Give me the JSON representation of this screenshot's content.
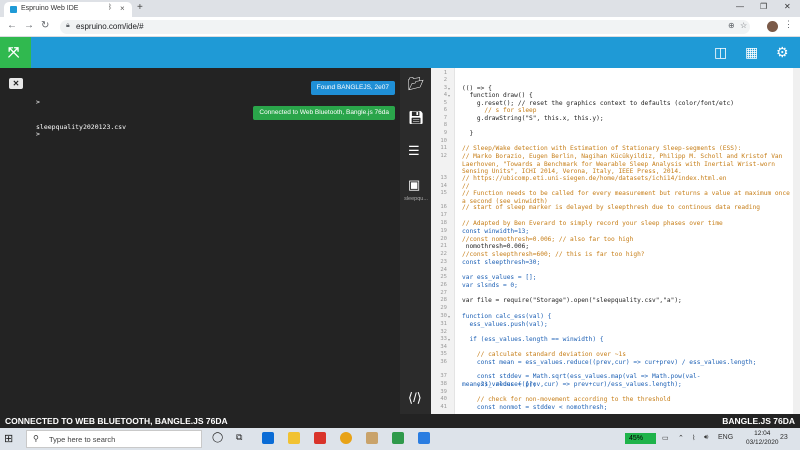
{
  "browser": {
    "tab_title": "Espruino Web IDE",
    "url": "espruino.com/ide/#"
  },
  "terminal": {
    "prompt_1": ">",
    "prompt_2": ">",
    "file_line": "sleepquality2020123.csv",
    "toast_found": "Found BANGLEJS, 2e07",
    "toast_connected": "Connected to Web Bluetooth, Bangle.js 76da"
  },
  "sidebar": {
    "tool_label": "sleepqu..."
  },
  "editor": {
    "lines": [
      {
        "n": "1",
        "t": "",
        "c": "plain"
      },
      {
        "n": "2",
        "t": "",
        "c": "plain"
      },
      {
        "n": "3",
        "t": "(() => {",
        "c": "plain",
        "f": true
      },
      {
        "n": "4",
        "t": "  function draw() {",
        "c": "plain",
        "f": true
      },
      {
        "n": "5",
        "t": "    g.reset(); // reset the graphics context to defaults (color/font/etc)",
        "c": "plain"
      },
      {
        "n": "6",
        "t": "      // s for sleep",
        "c": "comment"
      },
      {
        "n": "7",
        "t": "    g.drawString(\"S\", this.x, this.y);",
        "c": "plain"
      },
      {
        "n": "8",
        "t": "",
        "c": "plain"
      },
      {
        "n": "9",
        "t": "  }",
        "c": "plain"
      },
      {
        "n": "10",
        "t": "",
        "c": "plain"
      },
      {
        "n": "11",
        "t": "// Sleep/Wake detection with Estimation of Stationary Sleep-segments (ESS):",
        "c": "comment"
      },
      {
        "n": "12",
        "t": "// Marko Borazio, Eugen Berlin, Nagihan Kücükyildiz, Philipp M. Scholl and Kristof Van Laerhoven, \"Towards a Benchmark for Wearable Sleep Analysis with Inertial Wrist-worn Sensing Units\", ICHI 2014, Verona, Italy, IEEE Press, 2014.",
        "c": "comment"
      },
      {
        "n": "13",
        "t": "// https://ubicomp.eti.uni-siegen.de/home/datasets/ichi14/index.html.en",
        "c": "comment"
      },
      {
        "n": "14",
        "t": "//",
        "c": "comment"
      },
      {
        "n": "15",
        "t": "// Function needs to be called for every measurement but returns a value at maximum once a second (see winwidth)",
        "c": "comment"
      },
      {
        "n": "16",
        "t": "// start of sleep marker is delayed by sleepthresh due to continous data reading",
        "c": "comment"
      },
      {
        "n": "17",
        "t": "",
        "c": "plain"
      },
      {
        "n": "18",
        "t": "// Adapted by Ben Everard to simply record your sleep phases over time",
        "c": "comment"
      },
      {
        "n": "19",
        "t": "const winwidth=13;",
        "c": "kw"
      },
      {
        "n": "20",
        "t": "//const nomothresh=0.006; // also far too high",
        "c": "comment"
      },
      {
        "n": "21",
        "t": " nomothresh=0.006;",
        "c": "plain"
      },
      {
        "n": "22",
        "t": "//const sleepthresh=600; // this is far too high?",
        "c": "comment"
      },
      {
        "n": "23",
        "t": "const sleepthresh=30;",
        "c": "kw"
      },
      {
        "n": "24",
        "t": "",
        "c": "plain"
      },
      {
        "n": "25",
        "t": "var ess_values = [];",
        "c": "kw"
      },
      {
        "n": "26",
        "t": "var slsnds = 0;",
        "c": "kw"
      },
      {
        "n": "27",
        "t": "",
        "c": "plain"
      },
      {
        "n": "28",
        "t": "var file = require(\"Storage\").open(\"sleepquality.csv\",\"a\");",
        "c": "plain"
      },
      {
        "n": "29",
        "t": "",
        "c": "plain"
      },
      {
        "n": "30",
        "t": "function calc_ess(val) {",
        "c": "kw",
        "f": true
      },
      {
        "n": "31",
        "t": "  ess_values.push(val);",
        "c": "kw"
      },
      {
        "n": "32",
        "t": "",
        "c": "plain"
      },
      {
        "n": "33",
        "t": "  if (ess_values.length == winwidth) {",
        "c": "kw",
        "f": true
      },
      {
        "n": "34",
        "t": "",
        "c": "plain"
      },
      {
        "n": "35",
        "t": "    // calculate standard deviation over ~1s",
        "c": "comment"
      },
      {
        "n": "36",
        "t": "    const mean = ess_values.reduce((prev,cur) => cur+prev) / ess_values.length;",
        "c": "kw"
      },
      {
        "n": "37",
        "t": "    const stddev = Math.sqrt(ess_values.map(val => Math.pow(val-mean,2)).reduce((prev,cur) => prev+cur)/ess_values.length);",
        "c": "kw"
      },
      {
        "n": "38",
        "t": "    ess_values = [];",
        "c": "kw"
      },
      {
        "n": "39",
        "t": "",
        "c": "plain"
      },
      {
        "n": "40",
        "t": "    // check for non-movement according to the threshold",
        "c": "comment"
      },
      {
        "n": "41",
        "t": "    const nonmot = stddev < nomothresh;",
        "c": "kw"
      }
    ]
  },
  "status": {
    "left": "CONNECTED TO WEB BLUETOOTH, BANGLE.JS 76DA",
    "right": "BANGLE.JS 76DA"
  },
  "taskbar": {
    "search_placeholder": "Type here to search",
    "battery": "45%",
    "language": "ENG",
    "time": "12:04",
    "date": "03/12/2020",
    "notif_count": "23"
  },
  "colors": {
    "header_blue": "#1f9ad6",
    "logo_green": "#30b94f",
    "toast_blue": "#1f8fd6",
    "toast_green": "#2aa54a",
    "battery_green": "#1fb34a"
  }
}
